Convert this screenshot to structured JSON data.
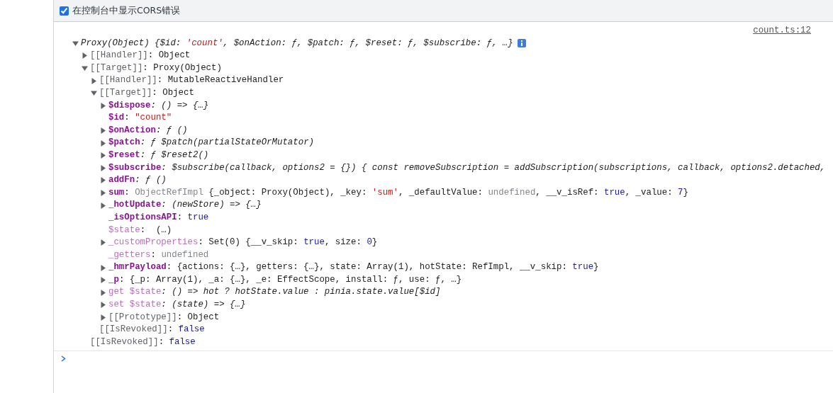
{
  "toolbar": {
    "checkbox": {
      "label": "在控制台中显示CORS错误",
      "checked": true
    }
  },
  "console": {
    "messages": [
      {
        "source": "count.ts:12",
        "tree": {
          "kind": "group",
          "expanded": true,
          "italic": true,
          "info_badge": true,
          "value": [
            {
              "kind": "plain",
              "text": "Proxy(Object) {$id: "
            },
            {
              "kind": "string",
              "text": "'count'"
            },
            {
              "kind": "plain",
              "text": ", $onAction: ƒ, $patch: ƒ, $reset: ƒ, $subscribe: ƒ, …}"
            }
          ],
          "children": [
            {
              "kind": "group",
              "expanded": false,
              "key": {
                "kind": "internal",
                "text": "[[Handler]]"
              },
              "value": [
                {
                  "kind": "plain",
                  "text": ": Object"
                }
              ]
            },
            {
              "kind": "group",
              "expanded": true,
              "key": {
                "kind": "internal",
                "text": "[[Target]]"
              },
              "value": [
                {
                  "kind": "plain",
                  "text": ": Proxy(Object)"
                }
              ],
              "children": [
                {
                  "kind": "group",
                  "expanded": false,
                  "key": {
                    "kind": "internal",
                    "text": "[[Handler]]"
                  },
                  "value": [
                    {
                      "kind": "plain",
                      "text": ": MutableReactiveHandler"
                    }
                  ]
                },
                {
                  "kind": "group",
                  "expanded": true,
                  "key": {
                    "kind": "internal",
                    "text": "[[Target]]"
                  },
                  "value": [
                    {
                      "kind": "plain",
                      "text": ": Object"
                    }
                  ],
                  "children": [
                    {
                      "kind": "group",
                      "expanded": false,
                      "key": {
                        "kind": "own",
                        "text": "$dispose"
                      },
                      "italic": true,
                      "value": [
                        {
                          "kind": "plain",
                          "text": ": () => {…}"
                        }
                      ]
                    },
                    {
                      "kind": "leaf",
                      "key": {
                        "kind": "own",
                        "text": "$id"
                      },
                      "value": [
                        {
                          "kind": "plain",
                          "text": ": "
                        },
                        {
                          "kind": "string",
                          "text": "\"count\""
                        }
                      ]
                    },
                    {
                      "kind": "group",
                      "expanded": false,
                      "key": {
                        "kind": "own",
                        "text": "$onAction"
                      },
                      "italic": true,
                      "value": [
                        {
                          "kind": "plain",
                          "text": ": ƒ ()"
                        }
                      ]
                    },
                    {
                      "kind": "group",
                      "expanded": false,
                      "key": {
                        "kind": "own",
                        "text": "$patch"
                      },
                      "italic": true,
                      "value": [
                        {
                          "kind": "plain",
                          "text": ": ƒ $patch(partialStateOrMutator)"
                        }
                      ]
                    },
                    {
                      "kind": "group",
                      "expanded": false,
                      "key": {
                        "kind": "own",
                        "text": "$reset"
                      },
                      "italic": true,
                      "value": [
                        {
                          "kind": "plain",
                          "text": ": ƒ $reset2()"
                        }
                      ]
                    },
                    {
                      "kind": "group",
                      "expanded": false,
                      "key": {
                        "kind": "own",
                        "text": "$subscribe"
                      },
                      "italic": true,
                      "value": [
                        {
                          "kind": "plain",
                          "text": ": $subscribe(callback, options2 = {}) { const removeSubscription = addSubscription(subscriptions, callback, options2.detached,"
                        }
                      ]
                    },
                    {
                      "kind": "group",
                      "expanded": false,
                      "key": {
                        "kind": "own",
                        "text": "addFn"
                      },
                      "italic": true,
                      "value": [
                        {
                          "kind": "plain",
                          "text": ": ƒ ()"
                        }
                      ]
                    },
                    {
                      "kind": "group",
                      "expanded": false,
                      "key": {
                        "kind": "own",
                        "text": "sum"
                      },
                      "value": [
                        {
                          "kind": "plain",
                          "text": ": "
                        },
                        {
                          "kind": "dim",
                          "text": "ObjectRefImpl"
                        },
                        {
                          "kind": "plain",
                          "text": " {_object: Proxy(Object), _key: "
                        },
                        {
                          "kind": "string",
                          "text": "'sum'"
                        },
                        {
                          "kind": "plain",
                          "text": ", _defaultValue: "
                        },
                        {
                          "kind": "dim",
                          "text": "undefined"
                        },
                        {
                          "kind": "plain",
                          "text": ", __v_isRef: "
                        },
                        {
                          "kind": "keyword",
                          "text": "true"
                        },
                        {
                          "kind": "plain",
                          "text": ", _value: "
                        },
                        {
                          "kind": "keyword",
                          "text": "7"
                        },
                        {
                          "kind": "plain",
                          "text": "}"
                        }
                      ]
                    },
                    {
                      "kind": "group",
                      "expanded": false,
                      "key": {
                        "kind": "own",
                        "text": "_hotUpdate"
                      },
                      "italic": true,
                      "value": [
                        {
                          "kind": "plain",
                          "text": ": (newStore) => {…}"
                        }
                      ]
                    },
                    {
                      "kind": "leaf",
                      "key": {
                        "kind": "own",
                        "text": "_isOptionsAPI"
                      },
                      "value": [
                        {
                          "kind": "plain",
                          "text": ": "
                        },
                        {
                          "kind": "keyword",
                          "text": "true"
                        }
                      ]
                    },
                    {
                      "kind": "leaf",
                      "key": {
                        "kind": "faded",
                        "text": "$state"
                      },
                      "value": [
                        {
                          "kind": "plain",
                          "text": ":  (…)"
                        }
                      ]
                    },
                    {
                      "kind": "group",
                      "expanded": false,
                      "key": {
                        "kind": "faded",
                        "text": "_customProperties"
                      },
                      "value": [
                        {
                          "kind": "plain",
                          "text": ": Set(0) {__v_skip: "
                        },
                        {
                          "kind": "keyword",
                          "text": "true"
                        },
                        {
                          "kind": "plain",
                          "text": ", size: "
                        },
                        {
                          "kind": "keyword",
                          "text": "0"
                        },
                        {
                          "kind": "plain",
                          "text": "}"
                        }
                      ]
                    },
                    {
                      "kind": "leaf",
                      "key": {
                        "kind": "faded",
                        "text": "_getters"
                      },
                      "value": [
                        {
                          "kind": "plain",
                          "text": ": "
                        },
                        {
                          "kind": "dim",
                          "text": "undefined"
                        }
                      ]
                    },
                    {
                      "kind": "group",
                      "expanded": false,
                      "key": {
                        "kind": "own",
                        "text": "_hmrPayload"
                      },
                      "value": [
                        {
                          "kind": "plain",
                          "text": ": {actions: {…}, getters: {…}, state: Array(1), hotState: RefImpl, __v_skip: "
                        },
                        {
                          "kind": "keyword",
                          "text": "true"
                        },
                        {
                          "kind": "plain",
                          "text": "}"
                        }
                      ]
                    },
                    {
                      "kind": "group",
                      "expanded": false,
                      "key": {
                        "kind": "own",
                        "text": "_p"
                      },
                      "value": [
                        {
                          "kind": "plain",
                          "text": ": {_p: Array(1), _a: {…}, _e: EffectScope, install: ƒ, use: ƒ, …}"
                        }
                      ]
                    },
                    {
                      "kind": "group",
                      "expanded": false,
                      "key": {
                        "kind": "faded",
                        "text": "get $state"
                      },
                      "italic": true,
                      "value": [
                        {
                          "kind": "plain",
                          "text": ": () => hot ? hotState.value : pinia.state.value[$id]"
                        }
                      ]
                    },
                    {
                      "kind": "group",
                      "expanded": false,
                      "key": {
                        "kind": "faded",
                        "text": "set $state"
                      },
                      "italic": true,
                      "value": [
                        {
                          "kind": "plain",
                          "text": ": (state) => {…}"
                        }
                      ]
                    },
                    {
                      "kind": "group",
                      "expanded": false,
                      "key": {
                        "kind": "internal",
                        "text": "[[Prototype]]"
                      },
                      "value": [
                        {
                          "kind": "plain",
                          "text": ": Object"
                        }
                      ]
                    }
                  ]
                },
                {
                  "kind": "leaf",
                  "key": {
                    "kind": "internal",
                    "text": "[[IsRevoked]]"
                  },
                  "value": [
                    {
                      "kind": "plain",
                      "text": ": "
                    },
                    {
                      "kind": "keyword",
                      "text": "false"
                    }
                  ]
                }
              ]
            },
            {
              "kind": "leaf",
              "key": {
                "kind": "internal",
                "text": "[[IsRevoked]]"
              },
              "value": [
                {
                  "kind": "plain",
                  "text": ": "
                },
                {
                  "kind": "keyword",
                  "text": "false"
                }
              ]
            }
          ]
        }
      }
    ]
  }
}
